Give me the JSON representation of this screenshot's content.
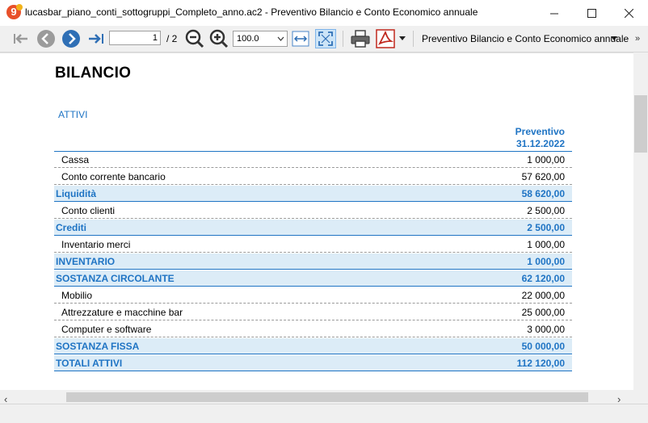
{
  "window": {
    "title": "lucasbar_piano_conti_sottogruppi_Completo_anno.ac2 - Preventivo Bilancio e Conto Economico annuale",
    "app_icon_text": "9"
  },
  "toolbar": {
    "page_current": "1",
    "page_total": "/ 2",
    "zoom": "100.0",
    "report_name": "Preventivo Bilancio e Conto Economico annuale"
  },
  "report": {
    "title": "BILANCIO",
    "section": "ATTIVI",
    "column_header_line1": "Preventivo",
    "column_header_line2": "31.12.2022",
    "rows": [
      {
        "label": "Cassa",
        "value": "1 000,00",
        "type": "detail"
      },
      {
        "label": "Conto corrente bancario",
        "value": "57 620,00",
        "type": "detail"
      },
      {
        "label": "Liquidità",
        "value": "58 620,00",
        "type": "total"
      },
      {
        "label": "Conto clienti",
        "value": "2 500,00",
        "type": "detail"
      },
      {
        "label": "Crediti",
        "value": "2 500,00",
        "type": "total"
      },
      {
        "label": "Inventario merci",
        "value": "1 000,00",
        "type": "detail"
      },
      {
        "label": "INVENTARIO",
        "value": "1 000,00",
        "type": "total"
      },
      {
        "label": "SOSTANZA CIRCOLANTE",
        "value": "62 120,00",
        "type": "total"
      },
      {
        "label": "Mobilio",
        "value": "22 000,00",
        "type": "detail"
      },
      {
        "label": "Attrezzature e macchine bar",
        "value": "25 000,00",
        "type": "detail"
      },
      {
        "label": "Computer e software",
        "value": "3 000,00",
        "type": "detail"
      },
      {
        "label": "SOSTANZA FISSA",
        "value": "50 000,00",
        "type": "total"
      },
      {
        "label": "TOTALI ATTIVI",
        "value": "112 120,00",
        "type": "total"
      }
    ]
  },
  "colors": {
    "accent": "#1f74c4",
    "total_row_bg": "#dcecf7"
  }
}
